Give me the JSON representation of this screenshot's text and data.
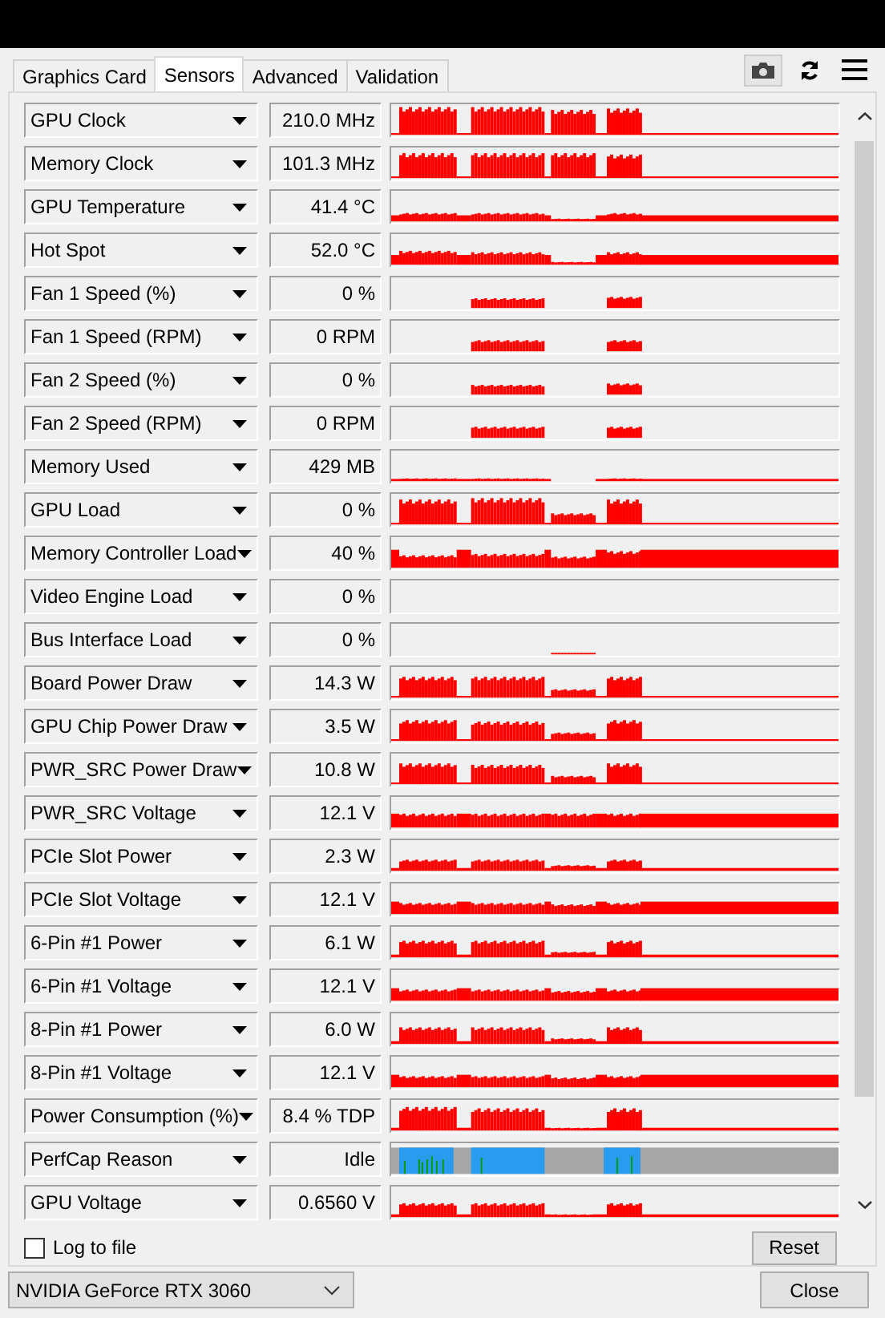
{
  "tabs": [
    {
      "label": "Graphics Card",
      "selected": false
    },
    {
      "label": "Sensors",
      "selected": true
    },
    {
      "label": "Advanced",
      "selected": false
    },
    {
      "label": "Validation",
      "selected": false
    }
  ],
  "sensors": [
    {
      "name": "GPU Clock",
      "value": "210.0 MHz",
      "kind": "graph"
    },
    {
      "name": "Memory Clock",
      "value": "101.3 MHz",
      "kind": "graph"
    },
    {
      "name": "GPU Temperature",
      "value": "41.4 °C",
      "kind": "graph"
    },
    {
      "name": "Hot Spot",
      "value": "52.0 °C",
      "kind": "graph"
    },
    {
      "name": "Fan 1 Speed (%)",
      "value": "0 %",
      "kind": "graph"
    },
    {
      "name": "Fan 1 Speed (RPM)",
      "value": "0 RPM",
      "kind": "graph"
    },
    {
      "name": "Fan 2 Speed (%)",
      "value": "0 %",
      "kind": "graph"
    },
    {
      "name": "Fan 2 Speed (RPM)",
      "value": "0 RPM",
      "kind": "graph"
    },
    {
      "name": "Memory Used",
      "value": "429 MB",
      "kind": "graph"
    },
    {
      "name": "GPU Load",
      "value": "0 %",
      "kind": "graph"
    },
    {
      "name": "Memory Controller Load",
      "value": "40 %",
      "kind": "graph"
    },
    {
      "name": "Video Engine Load",
      "value": "0 %",
      "kind": "graph"
    },
    {
      "name": "Bus Interface Load",
      "value": "0 %",
      "kind": "graph"
    },
    {
      "name": "Board Power Draw",
      "value": "14.3 W",
      "kind": "graph"
    },
    {
      "name": "GPU Chip Power Draw",
      "value": "3.5 W",
      "kind": "graph"
    },
    {
      "name": "PWR_SRC Power Draw",
      "value": "10.8 W",
      "kind": "graph"
    },
    {
      "name": "PWR_SRC Voltage",
      "value": "12.1 V",
      "kind": "graph"
    },
    {
      "name": "PCIe Slot Power",
      "value": "2.3 W",
      "kind": "graph"
    },
    {
      "name": "PCIe Slot Voltage",
      "value": "12.1 V",
      "kind": "graph"
    },
    {
      "name": "6-Pin #1 Power",
      "value": "6.1 W",
      "kind": "graph"
    },
    {
      "name": "6-Pin #1 Voltage",
      "value": "12.1 V",
      "kind": "graph"
    },
    {
      "name": "8-Pin #1 Power",
      "value": "6.0 W",
      "kind": "graph"
    },
    {
      "name": "8-Pin #1 Voltage",
      "value": "12.1 V",
      "kind": "graph"
    },
    {
      "name": "Power Consumption (%)",
      "value": "8.4 % TDP",
      "kind": "graph"
    },
    {
      "name": "PerfCap Reason",
      "value": "Idle",
      "kind": "perfcap"
    },
    {
      "name": "GPU Voltage",
      "value": "0.6560 V",
      "kind": "graph"
    }
  ],
  "log_to_file": {
    "label": "Log to file",
    "checked": false
  },
  "reset_button": "Reset",
  "gpu_select": "NVIDIA GeForce RTX 3060",
  "close_button": "Close"
}
